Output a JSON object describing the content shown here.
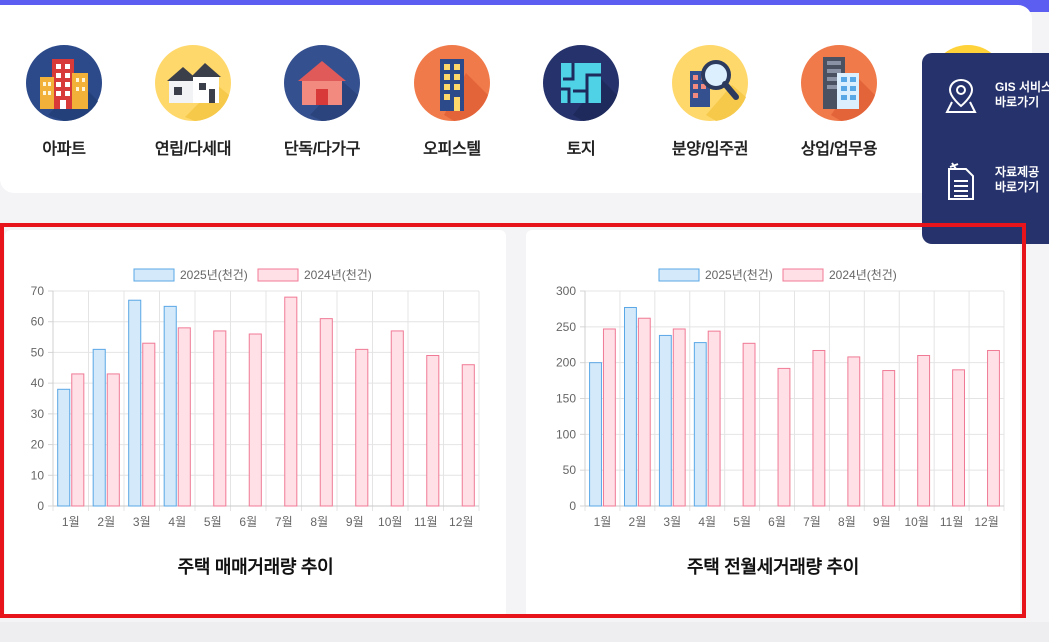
{
  "categories": [
    {
      "label": "아파트",
      "icon": "apartment-icon"
    },
    {
      "label": "연립/다세대",
      "icon": "row-house-icon"
    },
    {
      "label": "단독/다가구",
      "icon": "detached-house-icon"
    },
    {
      "label": "오피스텔",
      "icon": "officetel-icon"
    },
    {
      "label": "토지",
      "icon": "land-icon"
    },
    {
      "label": "분양/입주권",
      "icon": "presale-search-icon"
    },
    {
      "label": "상업/업무용",
      "icon": "commercial-building-icon"
    }
  ],
  "side_menu": [
    {
      "line1": "GIS 서비스",
      "line2": "바로가기",
      "icon": "map-pin-icon"
    },
    {
      "line1": "자료제공",
      "line2": "바로가기",
      "icon": "document-icon"
    }
  ],
  "colors": {
    "accent": "#5b5ef0",
    "side_bg": "#26326b",
    "highlight_border": "#e8141b",
    "series_2025_fill": "#d4eafa",
    "series_2025_stroke": "#5aa7e6",
    "series_2024_fill": "#ffe0e6",
    "series_2024_stroke": "#f07a95"
  },
  "chart_data": [
    {
      "type": "bar",
      "title": "주택 매매거래량 추이",
      "categories": [
        "1월",
        "2월",
        "3월",
        "4월",
        "5월",
        "6월",
        "7월",
        "8월",
        "9월",
        "10월",
        "11월",
        "12월"
      ],
      "series": [
        {
          "name": "2025년(천건)",
          "values": [
            38,
            51,
            67,
            65,
            null,
            null,
            null,
            null,
            null,
            null,
            null,
            null
          ]
        },
        {
          "name": "2024년(천건)",
          "values": [
            43,
            43,
            53,
            58,
            57,
            56,
            68,
            61,
            51,
            57,
            49,
            46
          ]
        }
      ],
      "ylim": [
        0,
        70
      ],
      "yticks": [
        0,
        10,
        20,
        30,
        40,
        50,
        60,
        70
      ],
      "grid": true,
      "legend": "top-center"
    },
    {
      "type": "bar",
      "title": "주택 전월세거래량 추이",
      "categories": [
        "1월",
        "2월",
        "3월",
        "4월",
        "5월",
        "6월",
        "7월",
        "8월",
        "9월",
        "10월",
        "11월",
        "12월"
      ],
      "series": [
        {
          "name": "2025년(천건)",
          "values": [
            200,
            277,
            238,
            228,
            null,
            null,
            null,
            null,
            null,
            null,
            null,
            null
          ]
        },
        {
          "name": "2024년(천건)",
          "values": [
            247,
            262,
            247,
            244,
            227,
            192,
            217,
            208,
            189,
            210,
            190,
            217
          ]
        }
      ],
      "ylim": [
        0,
        300
      ],
      "yticks": [
        0,
        50,
        100,
        150,
        200,
        250,
        300
      ],
      "grid": true,
      "legend": "top-center"
    }
  ]
}
